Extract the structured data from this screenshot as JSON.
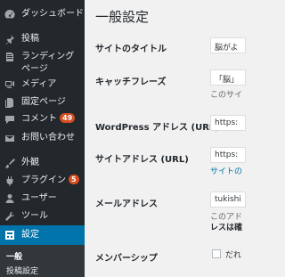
{
  "sidebar": {
    "items": [
      {
        "label": "ダッシュボード",
        "icon": "dashboard-icon"
      },
      {
        "label": "投稿",
        "icon": "pin-icon"
      },
      {
        "label": "ランディングページ",
        "icon": "landing-page-icon"
      },
      {
        "label": "メディア",
        "icon": "media-icon"
      },
      {
        "label": "固定ページ",
        "icon": "page-icon"
      },
      {
        "label": "コメント",
        "icon": "comment-icon",
        "badge": "49"
      },
      {
        "label": "お問い合わせ",
        "icon": "mail-icon"
      },
      {
        "label": "外観",
        "icon": "brush-icon"
      },
      {
        "label": "プラグイン",
        "icon": "plugin-icon",
        "badge": "5"
      },
      {
        "label": "ユーザー",
        "icon": "user-icon"
      },
      {
        "label": "ツール",
        "icon": "wrench-icon"
      },
      {
        "label": "設定",
        "icon": "settings-icon",
        "active": true
      }
    ],
    "submenu": [
      {
        "label": "一般",
        "current": true
      },
      {
        "label": "投稿設定"
      }
    ]
  },
  "main": {
    "title": "一般設定",
    "rows": {
      "site_title": {
        "label": "サイトのタイトル",
        "value": "脳がよ"
      },
      "tagline": {
        "label": "キャッチフレーズ",
        "value": "「脳」",
        "description": "このサイ"
      },
      "wp_address": {
        "label": "WordPress アドレス (URL)",
        "value": "https:"
      },
      "site_address": {
        "label": "サイトアドレス (URL)",
        "value": "https:",
        "link": "サイトの"
      },
      "email": {
        "label": "メールアドレス",
        "value": "tukishi",
        "description": "このアド",
        "description2": "レスは確"
      },
      "membership": {
        "label": "メンバーシップ",
        "checkbox_label": "だれ"
      }
    }
  },
  "colors": {
    "sidebar_bg": "#23282d",
    "active_bg": "#0073aa",
    "badge_bg": "#d54e21",
    "main_bg": "#f1f1f1",
    "link": "#0073aa"
  }
}
